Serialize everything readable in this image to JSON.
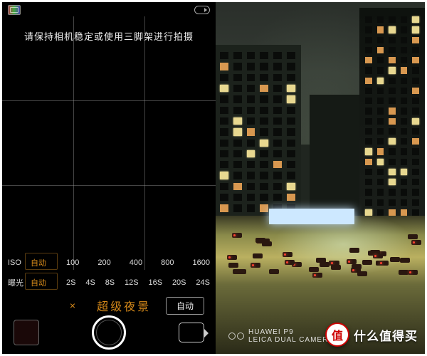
{
  "camera": {
    "hint": "请保持相机稳定或使用三脚架进行拍摄",
    "iso": {
      "label": "ISO",
      "auto": "自动",
      "options": [
        "100",
        "200",
        "400",
        "800",
        "1600"
      ]
    },
    "exposure": {
      "label": "曝光",
      "auto": "自动",
      "options": [
        "2S",
        "4S",
        "8S",
        "12S",
        "16S",
        "20S",
        "24S"
      ]
    },
    "mode_title": "超级夜景",
    "close_glyph": "×",
    "auto_button": "自动"
  },
  "watermark": {
    "device": "HUAWEI P9",
    "lens": "LEICA DUAL CAMERA"
  },
  "overlay": {
    "badge_char": "值",
    "brand_text": "什么值得买"
  },
  "colors": {
    "accent": "#d78a1a"
  }
}
